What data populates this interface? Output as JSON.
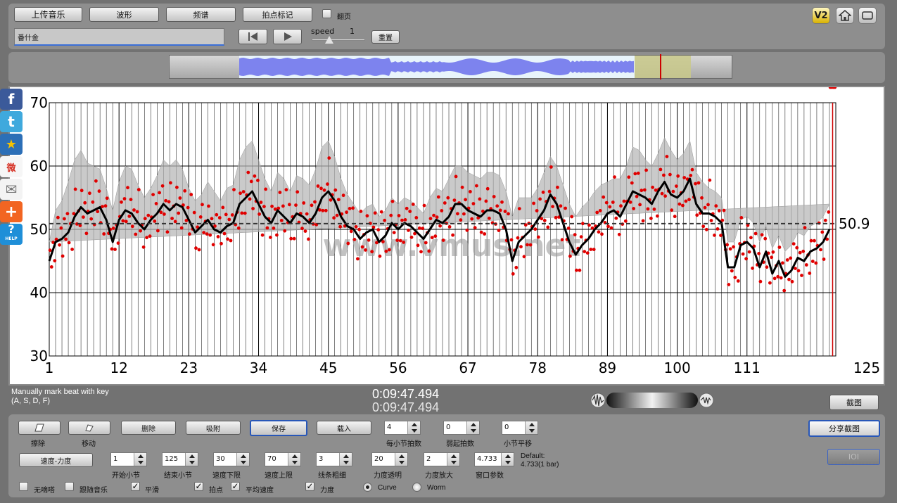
{
  "toolbar": {
    "upload_label": "上传音乐",
    "waveform_label": "波形",
    "spectrum_label": "频谱",
    "beat_mark_label": "拍点标记",
    "page_turn_label": "翻页",
    "page_turn_checked": false,
    "song_name": "番什金",
    "speed_label": "speed",
    "speed_value": "1",
    "reset_label": "重置"
  },
  "top_icons": [
    "V2",
    "home-icon",
    "fullscreen-icon"
  ],
  "overview": {
    "played_fraction": 0.87,
    "playhead_fraction": 0.87
  },
  "social_icons": [
    "facebook-icon",
    "twitter-icon",
    "favorite-icon",
    "weibo-icon",
    "mail-icon",
    "plus-icon",
    "help-icon"
  ],
  "social_letters": {
    "facebook": "f",
    "twitter": "t",
    "favorite": "★",
    "weibo": "微",
    "mail": "✉",
    "plus": "+",
    "help": "?"
  },
  "help_text": "HELP",
  "watermark": "www.vmus.net",
  "chart_data": {
    "type": "line",
    "ylim": [
      30,
      70
    ],
    "yticks": [
      "30",
      "40",
      "50",
      "60",
      "70"
    ],
    "xlim": [
      1,
      125
    ],
    "xticks": [
      "1",
      "12",
      "23",
      "34",
      "45",
      "56",
      "67",
      "78",
      "89",
      "100",
      "111",
      "125"
    ],
    "xtick_values": [
      1,
      12,
      23,
      34,
      45,
      56,
      67,
      78,
      89,
      100,
      111,
      125
    ],
    "average_label": "50.9",
    "average_value": 50.9,
    "smooth_tempo": {
      "x": [
        1,
        2,
        3,
        4,
        5,
        6,
        7,
        8,
        9,
        10,
        11,
        12,
        13,
        14,
        15,
        16,
        17,
        18,
        19,
        20,
        21,
        22,
        23,
        24,
        25,
        26,
        27,
        28,
        29,
        30,
        31,
        32,
        33,
        34,
        35,
        36,
        37,
        38,
        39,
        40,
        41,
        42,
        43,
        44,
        45,
        46,
        47,
        48,
        49,
        50,
        51,
        52,
        53,
        54,
        55,
        56,
        57,
        58,
        59,
        60,
        61,
        62,
        63,
        64,
        65,
        66,
        67,
        68,
        69,
        70,
        71,
        72,
        73,
        74,
        75,
        76,
        77,
        78,
        79,
        80,
        81,
        82,
        83,
        84,
        85,
        86,
        87,
        88,
        89,
        90,
        91,
        92,
        93,
        94,
        95,
        96,
        97,
        98,
        99,
        100,
        101,
        102,
        103,
        104,
        105,
        106,
        107,
        108,
        109,
        110,
        111,
        112,
        113,
        114,
        115,
        116,
        117,
        118,
        119,
        120,
        121,
        122,
        123,
        124,
        125
      ],
      "y": [
        45,
        48,
        48.5,
        49.5,
        52,
        53.5,
        52.5,
        53,
        53.5,
        51.5,
        48,
        51.5,
        53,
        52.5,
        51,
        50,
        51.5,
        52.5,
        54,
        53,
        54,
        53.5,
        51.5,
        49.5,
        50.5,
        51.5,
        50,
        49.5,
        50.5,
        51,
        54,
        55,
        56,
        54,
        52,
        51,
        53,
        52,
        51,
        52.5,
        52,
        51,
        52.5,
        55,
        56,
        54.5,
        52,
        50.5,
        50,
        48.5,
        49.5,
        50,
        48,
        49,
        51,
        50,
        51,
        50.5,
        49.5,
        48.5,
        50,
        51.5,
        51,
        52,
        54,
        54,
        53,
        52.5,
        52,
        53,
        53,
        52.5,
        50,
        45,
        48,
        49,
        50,
        51.5,
        53,
        55.5,
        54,
        51,
        48,
        46,
        47.5,
        48.5,
        50,
        51,
        52.5,
        53,
        52,
        54,
        56,
        55.5,
        55,
        54,
        56,
        57.5,
        55.5,
        55,
        56,
        58,
        54,
        52.5,
        52.5,
        52,
        51,
        44,
        44,
        47.5,
        48,
        47,
        44,
        46.5,
        43,
        45,
        42.5,
        43.5,
        45.5,
        45,
        46.5,
        47,
        48,
        50
      ]
    },
    "band_halfwidth": [
      3,
      5,
      6,
      8,
      9,
      9,
      8,
      7,
      6,
      5,
      5,
      6,
      7,
      7,
      6,
      5,
      5,
      6,
      7,
      7,
      7,
      6,
      5,
      5,
      5,
      6,
      6,
      5,
      6,
      6,
      7,
      8,
      8,
      7,
      6,
      5,
      6,
      6,
      5,
      6,
      6,
      6,
      7,
      8,
      8,
      7,
      6,
      5,
      4,
      4,
      4,
      4,
      4,
      4,
      4,
      4,
      4,
      4,
      4,
      4,
      5,
      5,
      5,
      6,
      6,
      6,
      6,
      6,
      6,
      6,
      6,
      6,
      6,
      7,
      7,
      6,
      5,
      5,
      6,
      6,
      6,
      6,
      6,
      6,
      6,
      6,
      6,
      6,
      5,
      5,
      6,
      6,
      7,
      7,
      6,
      6,
      6,
      7,
      7,
      6,
      6,
      6,
      5,
      5,
      4,
      4,
      4,
      4,
      4,
      4,
      4,
      4,
      4,
      4,
      4,
      4,
      4,
      4,
      4,
      4,
      4,
      4,
      4,
      4,
      4
    ],
    "scatter_offsets": [
      3.1,
      -2.4,
      1.7,
      -4.0,
      0.6,
      4.4,
      -1.3,
      2.6,
      -3.2,
      5.3,
      -0.8,
      3.8,
      -2.9,
      1.1,
      -4.6,
      2.0,
      6.2,
      -1.8,
      0.3,
      -3.6
    ]
  },
  "time_display": {
    "note_line1": "Manually mark beat with key",
    "note_line2": "(A, S, D, F)",
    "time1": "0:09:47.494",
    "time2": "0:09:47.494",
    "screenshot_label": "截图"
  },
  "controls": {
    "eraser_label": "擦除",
    "move_label": "移动",
    "delete_label": "删除",
    "snap_label": "吸附",
    "save_label": "保存",
    "load_label": "载入",
    "beats_per_bar_value": "4",
    "beats_per_bar_label": "每小节拍数",
    "pickup_value": "0",
    "pickup_label": "弱起拍数",
    "bar_shift_value": "0",
    "bar_shift_label": "小节平移",
    "share_label": "分享截图",
    "ioi_label": "IOI",
    "tempo_dynamics_label": "速度-力度",
    "start_bar_value": "1",
    "start_bar_label": "开始小节",
    "end_bar_value": "125",
    "end_bar_label": "结束小节",
    "tempo_min_value": "30",
    "tempo_min_label": "速度下限",
    "tempo_max_value": "70",
    "tempo_max_label": "速度上限",
    "line_width_value": "3",
    "line_width_label": "线条粗细",
    "dyn_alpha_value": "20",
    "dyn_alpha_label": "力度透明",
    "dyn_scale_value": "2",
    "dyn_scale_label": "力度放大",
    "window_value": "4.733",
    "window_label": "窗口参数",
    "default_line1": "Default:",
    "default_line2": "4.733(1 bar)",
    "no_beat_label": "无嘀嗒",
    "no_beat_checked": false,
    "follow_music_label": "跟随音乐",
    "follow_music_checked": false,
    "smooth_label": "平滑",
    "smooth_checked": true,
    "beat_points_label": "拍点",
    "beat_points_checked": true,
    "avg_tempo_label": "平均速度",
    "avg_tempo_checked": true,
    "dynamics_label": "力度",
    "dynamics_checked": true,
    "curve_label": "Curve",
    "curve_selected": true,
    "worm_label": "Worm",
    "worm_selected": false
  }
}
